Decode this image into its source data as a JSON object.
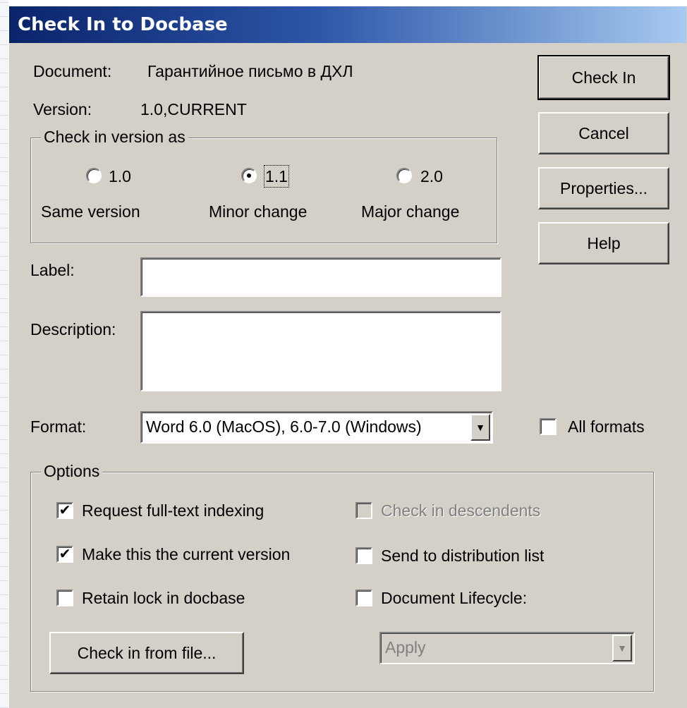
{
  "window": {
    "title": "Check In to Docbase"
  },
  "info": {
    "document_label": "Document:",
    "document_value": "Гарантийное письмо в ДХЛ",
    "version_label": "Version:",
    "version_value": "1.0,CURRENT"
  },
  "version_group": {
    "legend": "Check in version as",
    "options": [
      {
        "value": "1.0",
        "caption": "Same version",
        "selected": false
      },
      {
        "value": "1.1",
        "caption": "Minor change",
        "selected": true
      },
      {
        "value": "2.0",
        "caption": "Major change",
        "selected": false
      }
    ]
  },
  "buttons": {
    "check_in": "Check In",
    "cancel": "Cancel",
    "properties": "Properties...",
    "help": "Help",
    "check_in_from_file": "Check in from file..."
  },
  "fields": {
    "label_label": "Label:",
    "label_value": "",
    "description_label": "Description:",
    "description_value": "",
    "format_label": "Format:",
    "format_value": "Word 6.0 (MacOS), 6.0-7.0 (Windows)",
    "all_formats_label": "All formats",
    "all_formats_checked": false
  },
  "options_group": {
    "legend": "Options",
    "request_fulltext": {
      "label": "Request full-text indexing",
      "checked": true
    },
    "make_current": {
      "label": "Make this the current version",
      "checked": true
    },
    "retain_lock": {
      "label": "Retain lock in docbase",
      "checked": false
    },
    "check_descendents": {
      "label": "Check in descendents",
      "checked": false,
      "disabled": true
    },
    "send_distribution": {
      "label": "Send to distribution list",
      "checked": false
    },
    "doc_lifecycle": {
      "label": "Document Lifecycle:",
      "checked": false
    },
    "lifecycle_select": "Apply"
  },
  "colors": {
    "dialog_bg": "#d4d0c8",
    "title_start": "#0a246a",
    "title_end": "#a6caf0"
  }
}
